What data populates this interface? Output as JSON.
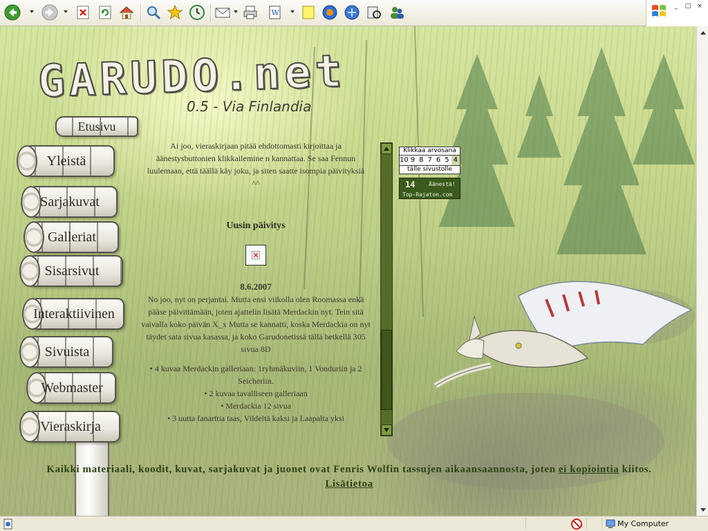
{
  "toolbar": {
    "buttons": [
      "back-icon",
      "forward-icon",
      "stop-icon",
      "refresh-icon",
      "home-icon",
      "search-icon",
      "favorites-icon",
      "history-icon",
      "mail-icon",
      "print-icon",
      "edit-icon",
      "notes-icon",
      "messenger-icon",
      "research-icon",
      "media-icon",
      "contacts-icon"
    ]
  },
  "window": {
    "controls": [
      "_",
      "□",
      "×"
    ]
  },
  "header": {
    "logo": "GARUDO.net",
    "subtitle": "0.5 - Via Finlandia"
  },
  "nav": {
    "items": [
      {
        "label": "Etusivu"
      },
      {
        "label": "Yleistä"
      },
      {
        "label": "Sarjakuvat"
      },
      {
        "label": "Galleriat"
      },
      {
        "label": "Sisarsivut"
      },
      {
        "label": "Interaktiivinen"
      },
      {
        "label": "Sivuista"
      },
      {
        "label": "Webmaster"
      },
      {
        "label": "Vieraskirja"
      }
    ]
  },
  "content": {
    "intro": "Ai joo, vieraskirjaan pitää ehdottomasti kirjoittaa ja äänestysbuttonien klikkailemine n kannattaa. Se saa Fennun luulemaan, että täällä käy joku, ja siten saatte isompia päivityksiä ^^",
    "update_heading": "Uusin päivitys",
    "date": "8.6.2007",
    "body": "No joo, nyt on perjantai. Mutta ensi viikolla olen Roomassa enkä pääse päivittämään, joten ajattelin lisätä Merdackin nyt. Tein sitä vaivalla koko päivän X_x Mutta se kannatti, koska Merdackia on nyt täydet sata sivua kasassa, ja koko Garudonetissä tällä hetkellä 305 sivua 8D",
    "bullets": [
      "4 kuvaa Merdackin galleriaan: 1ryhmäkuviin, 1 Vonduriin ja 2 Seicheriin.",
      "2 kuvaa tavalliseen galleriaan",
      "Merdackia 12 sivua",
      "3 uutta fanarttia taas, Vildeltä kaksi ja Laapalta yksi"
    ]
  },
  "vote": {
    "header": "Klikkaa arvosana",
    "numbers": [
      "10",
      "9",
      "8",
      "7",
      "6",
      "5",
      "4"
    ],
    "footer": "tälle sivustolle",
    "badge_count": "14",
    "badge_action": "Äänestä!",
    "badge_site": "Top-Rajaton.com"
  },
  "footer": {
    "text_before": "Kaikki materiaali, koodit, kuvat, sarjakuvat ja juonet ovat Fenris Wolfin tassujen aikaansaannosta, joten ",
    "link1": "ei kopiointia",
    "text_after": " kiitos.",
    "link2": "Lisätietoa"
  },
  "statusbar": {
    "zone": "My Computer"
  }
}
